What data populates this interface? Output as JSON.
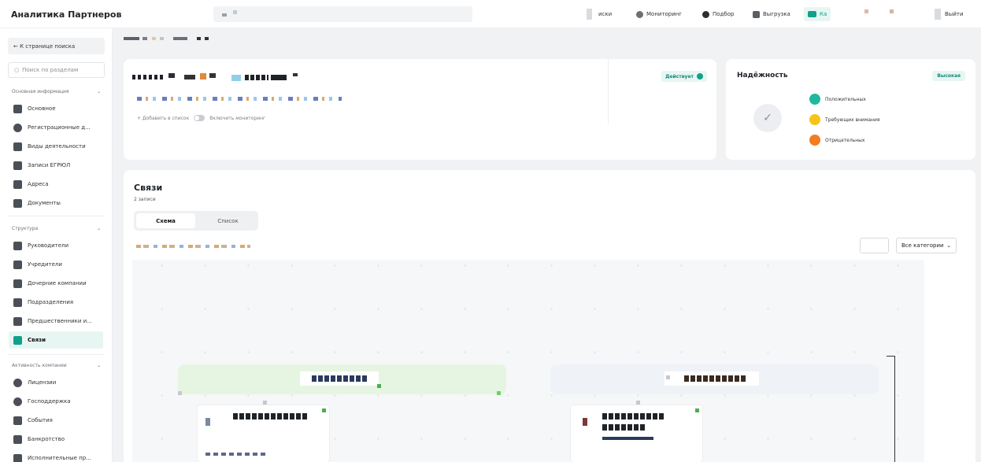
{
  "app": {
    "title": "Аналитика Партнеров"
  },
  "header": {
    "nav": [
      {
        "label": "иски",
        "icon": "doc-icon"
      },
      {
        "label": "Мониторинг",
        "icon": "eye-icon"
      },
      {
        "label": "Подбор",
        "icon": "target-icon"
      },
      {
        "label": "Выгрузка",
        "icon": "download-icon"
      },
      {
        "label": "Ка",
        "icon": "card-icon",
        "active": true
      }
    ],
    "logout_label": "Выйти"
  },
  "sidebar": {
    "back_label": "← К странице поиска",
    "search_placeholder": "Поиск по разделам",
    "sections": [
      {
        "title": "Основная информация",
        "items": [
          {
            "label": "Основное",
            "icon": "grid-icon"
          },
          {
            "label": "Регистрационные д...",
            "icon": "info-icon"
          },
          {
            "label": "Виды деятельности",
            "icon": "clipboard-icon"
          },
          {
            "label": "Записи ЕГРЮЛ",
            "icon": "list-icon"
          },
          {
            "label": "Адреса",
            "icon": "map-pin-icon"
          },
          {
            "label": "Документы",
            "icon": "document-icon"
          }
        ]
      },
      {
        "title": "Структура",
        "items": [
          {
            "label": "Руководители",
            "icon": "people-icon"
          },
          {
            "label": "Учредители",
            "icon": "network-icon"
          },
          {
            "label": "Дочерние компании",
            "icon": "tree-icon"
          },
          {
            "label": "Подразделения",
            "icon": "org-icon"
          },
          {
            "label": "Предшественники и...",
            "icon": "history-icon"
          },
          {
            "label": "Связи",
            "icon": "links-icon",
            "active": true
          }
        ]
      },
      {
        "title": "Активность компании",
        "items": [
          {
            "label": "Лицензии",
            "icon": "license-icon"
          },
          {
            "label": "Господдержка",
            "icon": "support-icon"
          },
          {
            "label": "События",
            "icon": "events-icon"
          },
          {
            "label": "Банкротство",
            "icon": "bankruptcy-icon"
          },
          {
            "label": "Исполнительные пр...",
            "icon": "enforcement-icon"
          }
        ]
      }
    ]
  },
  "org": {
    "status_label": "Действует",
    "add_to_list_label": "+ Добавить в список",
    "monitoring_label": "Включить мониторинг"
  },
  "reliability": {
    "title": "Надёжность",
    "level": "Высокая",
    "legend": [
      {
        "label": "Положительных",
        "color": "#20b89f"
      },
      {
        "label": "Требующих внимания",
        "color": "#f6c41a"
      },
      {
        "label": "Отрицательных",
        "color": "#f47b20"
      }
    ]
  },
  "links": {
    "title": "Связи",
    "count": "2 записи",
    "tabs": [
      {
        "label": "Схема",
        "active": true
      },
      {
        "label": "Список",
        "active": false
      }
    ],
    "category_select": "Все категории"
  },
  "colors": {
    "accent": "#12a08a",
    "accent_bg": "#e8f6f3"
  }
}
